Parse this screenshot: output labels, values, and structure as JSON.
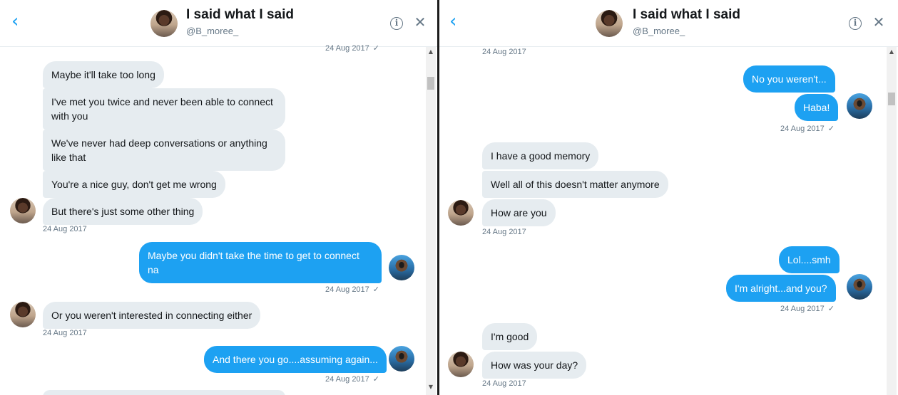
{
  "conversation": {
    "title": "I said what I said",
    "handle": "@B_moree_"
  },
  "icons": {
    "back": "chevron-left-icon",
    "info": "info-icon",
    "close": "close-icon"
  },
  "colors": {
    "outgoing_bubble": "#1da1f2",
    "incoming_bubble": "#e6ecf0",
    "timestamp": "#657786"
  },
  "left_panel": {
    "top_timestamp": "24 Aug 2017",
    "messages": [
      {
        "text": "Maybe it'll take too long",
        "from": "them"
      },
      {
        "text": "I've met you twice and never been able to connect with you",
        "from": "them"
      },
      {
        "text": "We've never had deep conversations or anything like that",
        "from": "them"
      },
      {
        "text": "You're a nice guy, don't get me wrong",
        "from": "them"
      },
      {
        "text": "But there's just some other thing",
        "from": "them"
      },
      {
        "text": "Maybe you didn't take the time to get to connect na",
        "from": "me"
      },
      {
        "text": "Or you weren't interested in connecting either",
        "from": "them"
      },
      {
        "text": "And there you go....assuming again...",
        "from": "me"
      }
    ],
    "timestamps": [
      "24 Aug 2017",
      "24 Aug 2017",
      "24 Aug 2017",
      "24 Aug 2017"
    ]
  },
  "right_panel": {
    "top_timestamp": "24 Aug 2017",
    "messages": [
      {
        "text": "No you weren't...",
        "from": "me"
      },
      {
        "text": "Haba!",
        "from": "me"
      },
      {
        "text": "I have a good memory",
        "from": "them"
      },
      {
        "text": "Well all of this doesn't matter anymore",
        "from": "them"
      },
      {
        "text": "How are you",
        "from": "them"
      },
      {
        "text": "Lol....smh",
        "from": "me"
      },
      {
        "text": "I'm alright...and you?",
        "from": "me"
      },
      {
        "text": "I'm good",
        "from": "them"
      },
      {
        "text": "How was your day?",
        "from": "them"
      }
    ],
    "timestamps": [
      "24 Aug 2017",
      "24 Aug 2017",
      "24 Aug 2017",
      "24 Aug 2017"
    ]
  },
  "check_glyph": "✓"
}
